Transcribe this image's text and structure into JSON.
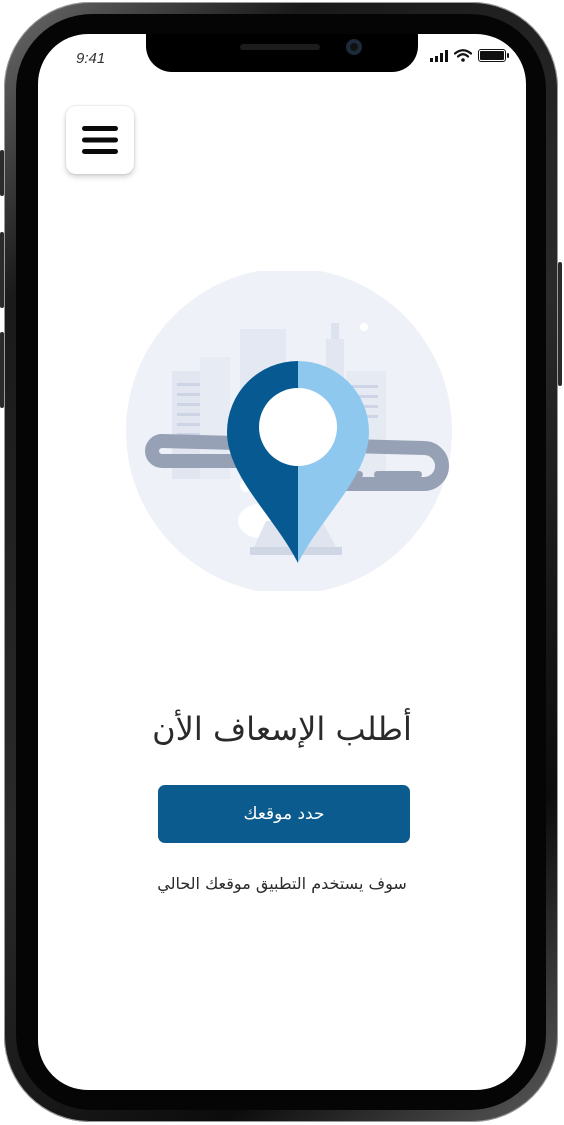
{
  "status_bar": {
    "time": "9:41"
  },
  "header": {
    "menu_icon": "hamburger-menu-icon"
  },
  "hero": {
    "illustration_icon": "location-pin-icon"
  },
  "main": {
    "title": "أطلب الإسعاف الأن",
    "cta_label": "حدد موقعك",
    "note": "سوف يستخدم التطبيق موقعك الحالي"
  },
  "colors": {
    "primary": "#0b5b8e",
    "pin_dark": "#065a91",
    "pin_light": "#8ec8ef",
    "road": "#97a1b6",
    "background_circle": "#eef1f7"
  }
}
